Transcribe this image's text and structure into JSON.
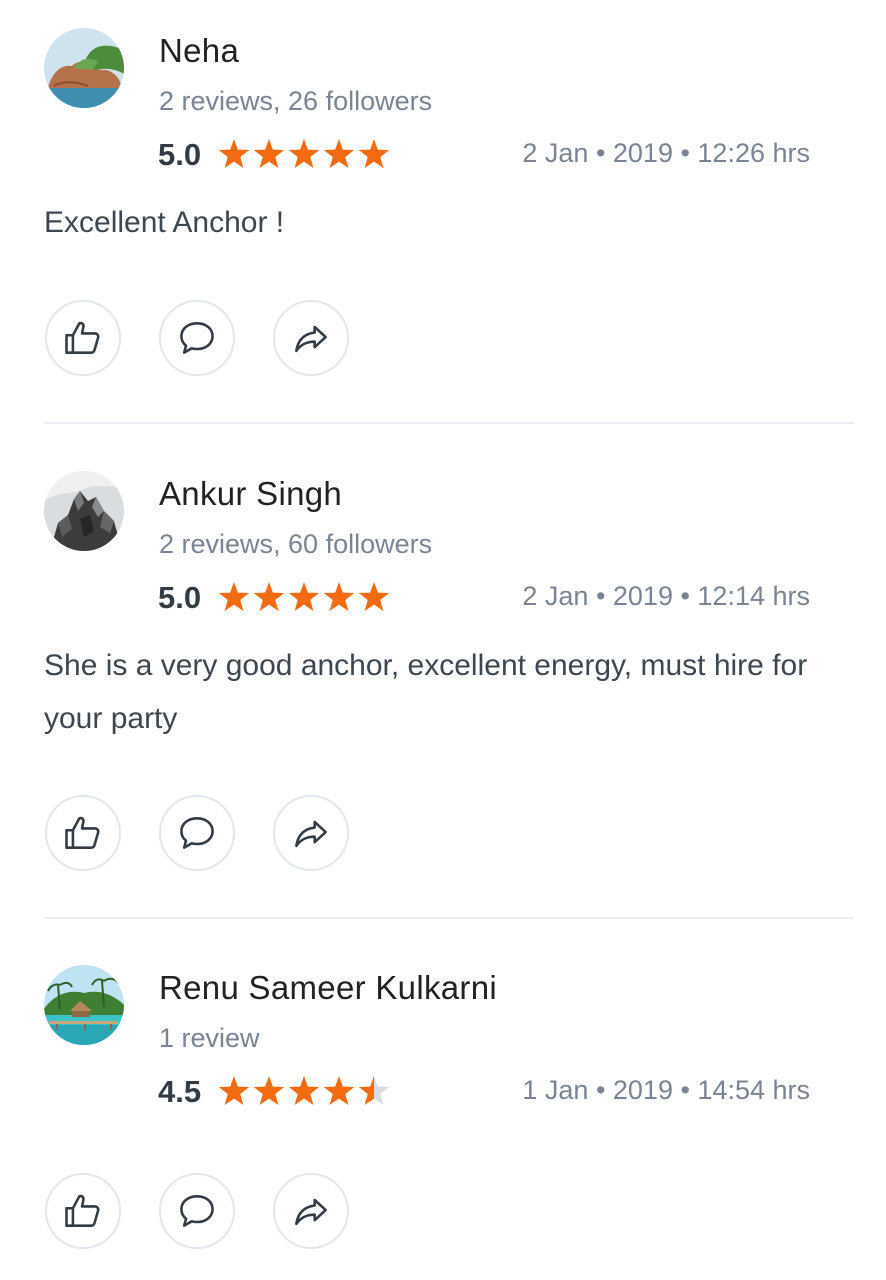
{
  "reviews": [
    {
      "name": "Neha",
      "meta": "2 reviews, 26 followers",
      "rating": "5.0",
      "rating_value": 5.0,
      "date": "2 Jan • 2019 • 12:26 hrs",
      "text": "Excellent Anchor !",
      "avatar_icon": "landscape-coast-icon"
    },
    {
      "name": "Ankur Singh",
      "meta": "2 reviews, 60 followers",
      "rating": "5.0",
      "rating_value": 5.0,
      "date": "2 Jan • 2019 • 12:14 hrs",
      "text": "She is a very good anchor, excellent energy, must hire for your party",
      "avatar_icon": "rock-mountain-icon"
    },
    {
      "name": "Renu Sameer Kulkarni",
      "meta": "1 review",
      "rating": "4.5",
      "rating_value": 4.5,
      "date": "1 Jan • 2019 • 14:54 hrs",
      "text": "",
      "avatar_icon": "beach-resort-icon"
    }
  ],
  "actions": {
    "like_icon": "thumbs-up-icon",
    "comment_icon": "comment-bubble-icon",
    "share_icon": "share-arrow-icon"
  },
  "colors": {
    "star": "#f26b11",
    "star_empty": "#d9dde2",
    "name": "#222222",
    "meta": "#7a8492",
    "border": "#e3e6ea"
  }
}
